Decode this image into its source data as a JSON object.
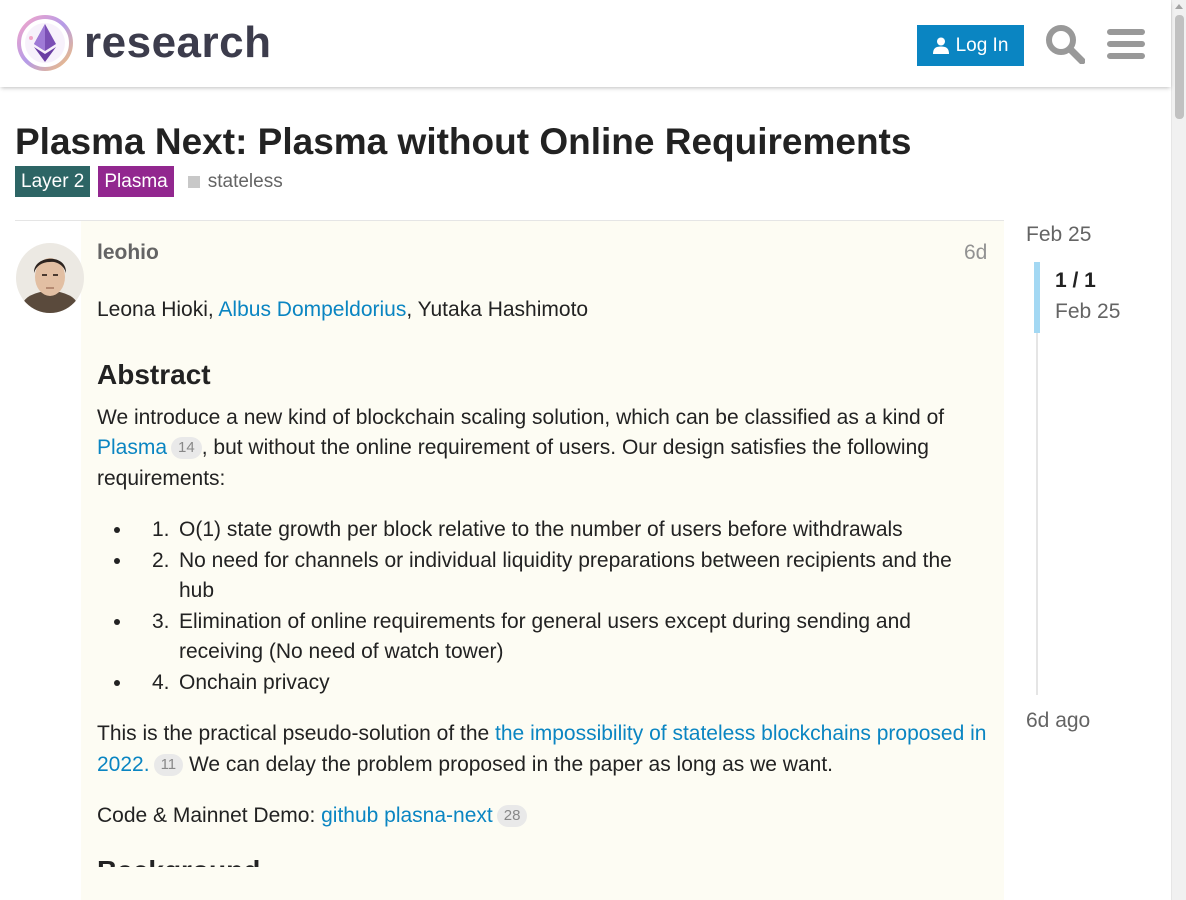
{
  "header": {
    "logo_text": "research",
    "login_label": "Log In"
  },
  "topic": {
    "title": "Plasma Next: Plasma without Online Requirements",
    "categories": [
      {
        "label": "Layer 2",
        "color": "#2d6565"
      },
      {
        "label": "Plasma",
        "color": "#92278f"
      }
    ],
    "tags": [
      "stateless"
    ]
  },
  "post": {
    "username": "leohio",
    "age": "6d",
    "authors": {
      "before": "Leona Hioki, ",
      "link": "Albus Dompeldorius",
      "after": ", Yutaka Hashimoto"
    },
    "abstract_heading": "Abstract",
    "intro": {
      "before": "We introduce a new kind of blockchain scaling solution, which can be classified as a kind of ",
      "link": "Plasma",
      "link_count": "14",
      "after": ", but without the online requirement of users. Our design satisfies the following requirements:"
    },
    "requirements": [
      {
        "num": "1.",
        "text": "O(1) state growth per block relative to the number of users before withdrawals"
      },
      {
        "num": "2.",
        "text": "No need for channels or individual liquidity preparations between recipients and the hub"
      },
      {
        "num": "3.",
        "text": "Elimination of online requirements for general users except during sending and receiving (No need of watch tower)"
      },
      {
        "num": "4.",
        "text": "Onchain privacy"
      }
    ],
    "practical": {
      "before": "This is the practical pseudo-solution of the ",
      "link": "the impossibility of stateless blockchains proposed in 2022.",
      "link_count": "11",
      "after": " We can delay the problem proposed in the paper as long as we want."
    },
    "demo": {
      "before": "Code & Mainnet Demo: ",
      "link": "github plasna-next",
      "link_count": "28"
    },
    "next_heading": "Background"
  },
  "timeline": {
    "start": "Feb 25",
    "position": "1 / 1",
    "position_date": "Feb 25",
    "end": "6d ago"
  },
  "colors": {
    "accent": "#0a85c2",
    "post_background": "#fdfcf3",
    "timeline_handle": "#a3d8f3"
  },
  "icons": {
    "login": "user-icon",
    "search": "search-icon",
    "menu": "hamburger-menu-icon"
  }
}
